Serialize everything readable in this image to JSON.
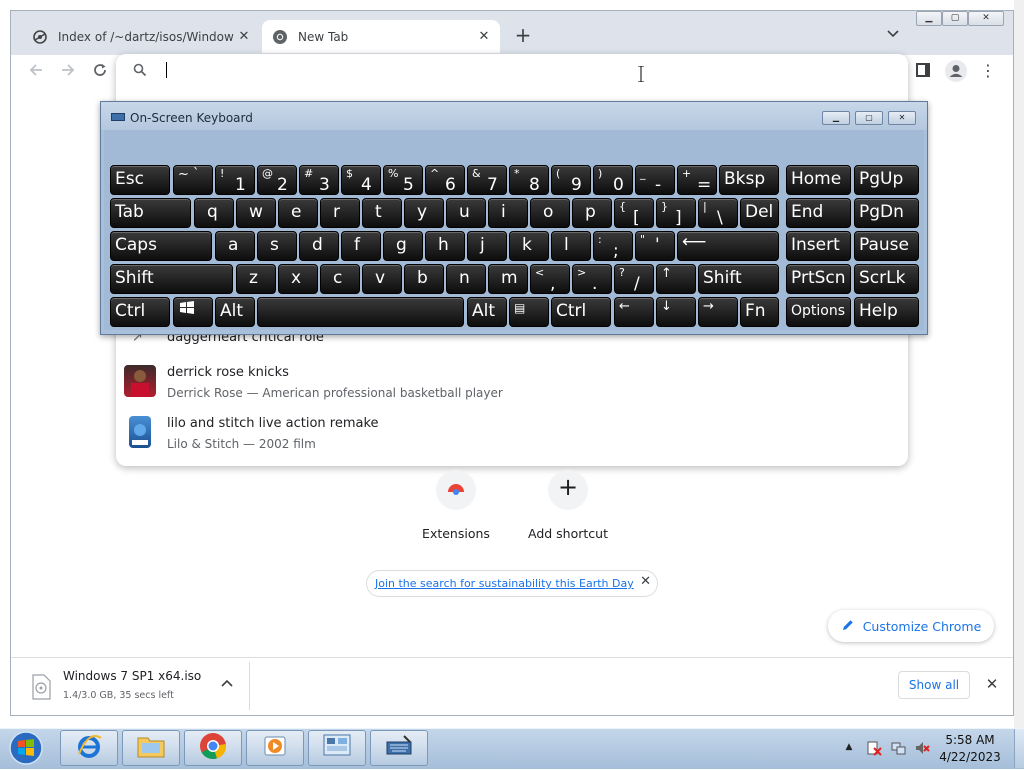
{
  "browser": {
    "tabs": [
      {
        "label": "Index of /~dartz/isos/Windows/",
        "icon": "site-favicon-icon"
      },
      {
        "label": "New Tab",
        "icon": "chrome-favicon-icon"
      }
    ],
    "omnibox_value": ""
  },
  "suggestions": [
    {
      "title": "daggerheart critical role",
      "subtitle": "",
      "icon": "trending-icon"
    },
    {
      "title": "derrick rose knicks",
      "subtitle": "Derrick Rose — American professional basketball player"
    },
    {
      "title": "lilo and stitch live action remake",
      "subtitle": "Lilo & Stitch — 2002 film"
    }
  ],
  "shortcuts": [
    {
      "label": "Extensions"
    },
    {
      "label": "Add shortcut"
    }
  ],
  "promo": {
    "link": "Join the search for sustainability this Earth Day"
  },
  "customize": {
    "label": "Customize Chrome"
  },
  "download": {
    "filename": "Windows 7 SP1 x64.iso",
    "status": "1.4/3.0 GB, 35 secs left",
    "show_all": "Show all"
  },
  "osk": {
    "title": "On-Screen Keyboard",
    "row1": {
      "esc": "Esc",
      "k1": [
        "~ `",
        "",
        "1",
        "!"
      ],
      "bksp": "Bksp",
      "home": "Home",
      "pgup": "PgUp"
    },
    "row2": {
      "tab": "Tab",
      "del": "Del",
      "end": "End",
      "pgdn": "PgDn"
    },
    "row3": {
      "caps": "Caps",
      "insert": "Insert",
      "pause": "Pause"
    },
    "row4": {
      "shift": "Shift",
      "shift_r": "Shift",
      "prtscn": "PrtScn",
      "scrlk": "ScrLk"
    },
    "row5": {
      "ctrl": "Ctrl",
      "alt": "Alt",
      "alt_r": "Alt",
      "ctrl_r": "Ctrl",
      "fn": "Fn",
      "options": "Options",
      "help": "Help"
    },
    "letters": {
      "r2": [
        "q",
        "w",
        "e",
        "r",
        "t",
        "y",
        "u",
        "i",
        "o",
        "p"
      ],
      "r3": [
        "a",
        "s",
        "d",
        "f",
        "g",
        "h",
        "j",
        "k",
        "l"
      ],
      "r4": [
        "z",
        "x",
        "c",
        "v",
        "b",
        "n",
        "m"
      ]
    },
    "numbers": {
      "shift": [
        "!",
        "@",
        "#",
        "$",
        "%",
        "^",
        "&",
        "*",
        "(",
        ")"
      ],
      "main": [
        "1",
        "2",
        "3",
        "4",
        "5",
        "6",
        "7",
        "8",
        "9",
        "0"
      ]
    }
  },
  "taskbar": {
    "time": "5:58 AM",
    "date": "4/22/2023"
  }
}
